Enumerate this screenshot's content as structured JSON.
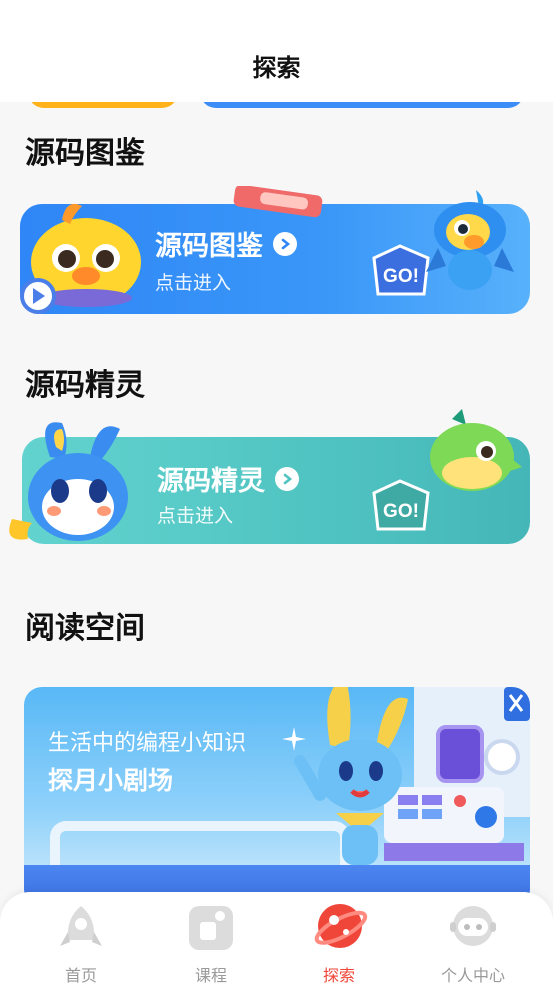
{
  "header": {
    "title": "探索"
  },
  "sections": {
    "pokedex": {
      "title": "源码图鉴",
      "card_name": "源码图鉴",
      "card_enter": "点击进入",
      "go": "GO!"
    },
    "sprite": {
      "title": "源码精灵",
      "card_name": "源码精灵",
      "card_enter": "点击进入",
      "go": "GO!"
    },
    "reading": {
      "title": "阅读空间",
      "subtitle": "生活中的编程小知识",
      "headline": "探月小剧场"
    }
  },
  "tabbar": {
    "items": [
      {
        "label": "首页",
        "icon": "rocket-icon"
      },
      {
        "label": "课程",
        "icon": "course-icon"
      },
      {
        "label": "探索",
        "icon": "planet-icon",
        "active": true
      },
      {
        "label": "个人中心",
        "icon": "astronaut-icon"
      }
    ]
  },
  "colors": {
    "active_tab": "#f0463a",
    "inactive_tab": "#9a9a9a",
    "card_blue": "#2f86f6",
    "card_teal": "#4fc3c1"
  }
}
